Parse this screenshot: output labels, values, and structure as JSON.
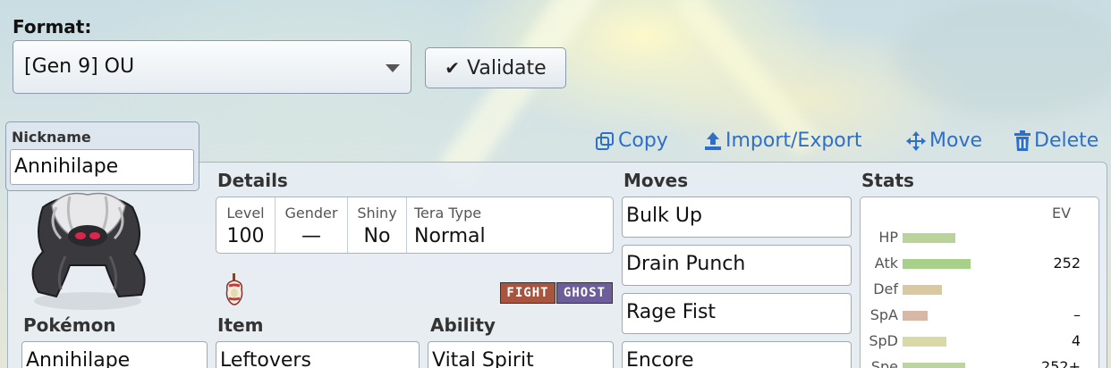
{
  "format": {
    "label": "Format:",
    "selected": "[Gen 9] OU"
  },
  "validate": {
    "label": "Validate"
  },
  "toolbar": {
    "copy": "Copy",
    "import_export": "Import/Export",
    "move": "Move",
    "delete": "Delete"
  },
  "nickname": {
    "label": "Nickname",
    "value": "Annihilape"
  },
  "details": {
    "heading": "Details",
    "level_label": "Level",
    "level": "100",
    "gender_label": "Gender",
    "gender": "—",
    "shiny_label": "Shiny",
    "shiny": "No",
    "tera_label": "Tera Type",
    "tera": "Normal"
  },
  "types": [
    "FIGHT",
    "GHOST"
  ],
  "pokemon": {
    "heading": "Pokémon",
    "value": "Annihilape"
  },
  "item": {
    "heading": "Item",
    "value": "Leftovers",
    "icon": "leftovers-icon"
  },
  "ability": {
    "heading": "Ability",
    "value": "Vital Spirit"
  },
  "moves": {
    "heading": "Moves",
    "list": [
      "Bulk Up",
      "Drain Punch",
      "Rage Fist",
      "Encore"
    ]
  },
  "stats": {
    "heading": "Stats",
    "ev_label": "EV",
    "rows": [
      {
        "name": "HP",
        "ev": "",
        "bar_fraction": 0.49,
        "color": "#b9d39a"
      },
      {
        "name": "Atk",
        "ev": "252",
        "bar_fraction": 0.63,
        "color": "#a8d08a"
      },
      {
        "name": "Def",
        "ev": "",
        "bar_fraction": 0.37,
        "color": "#d9c9a0"
      },
      {
        "name": "SpA",
        "ev": "–",
        "bar_fraction": 0.23,
        "color": "#d7b7a6"
      },
      {
        "name": "SpD",
        "ev": "4",
        "bar_fraction": 0.41,
        "color": "#d8d9a4"
      },
      {
        "name": "Spe",
        "ev": "252+",
        "bar_fraction": 0.58,
        "color": "#bcd5a0"
      }
    ]
  },
  "colors": {
    "link": "#2d6fc9",
    "fight": "#a8543f",
    "ghost": "#6d5d9b"
  }
}
